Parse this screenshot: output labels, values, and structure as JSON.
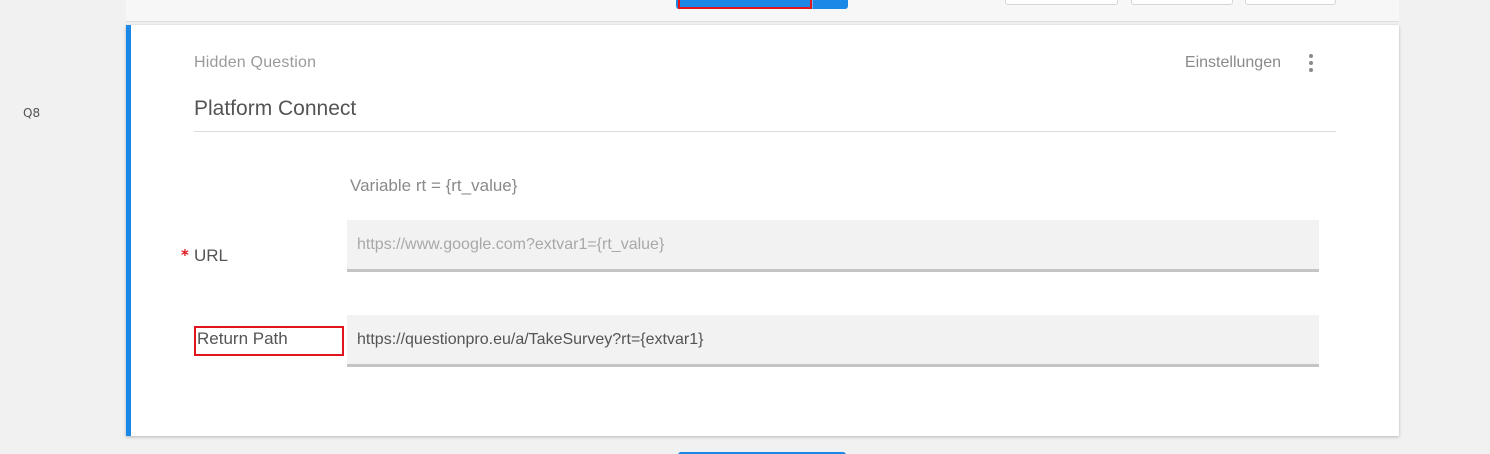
{
  "gutter": {
    "question_number": "Q8"
  },
  "question": {
    "type_label": "Hidden Question",
    "settings_label": "Einstellungen",
    "title": "Platform Connect",
    "variable_hint": "Variable rt = {rt_value}",
    "fields": {
      "url": {
        "label": "URL",
        "required_marker": "*",
        "placeholder": "https://www.google.com?extvar1={rt_value}",
        "value": ""
      },
      "return_path": {
        "label": "Return Path",
        "value": "https://questionpro.eu/a/TakeSurvey?rt={extvar1}"
      }
    }
  },
  "colors": {
    "accent": "#1b87e6",
    "highlight": "#e0151d",
    "required": "#e0151d",
    "background": "#f1f1f1",
    "card": "#ffffff"
  },
  "icons": {
    "more": "more-vertical-icon"
  }
}
